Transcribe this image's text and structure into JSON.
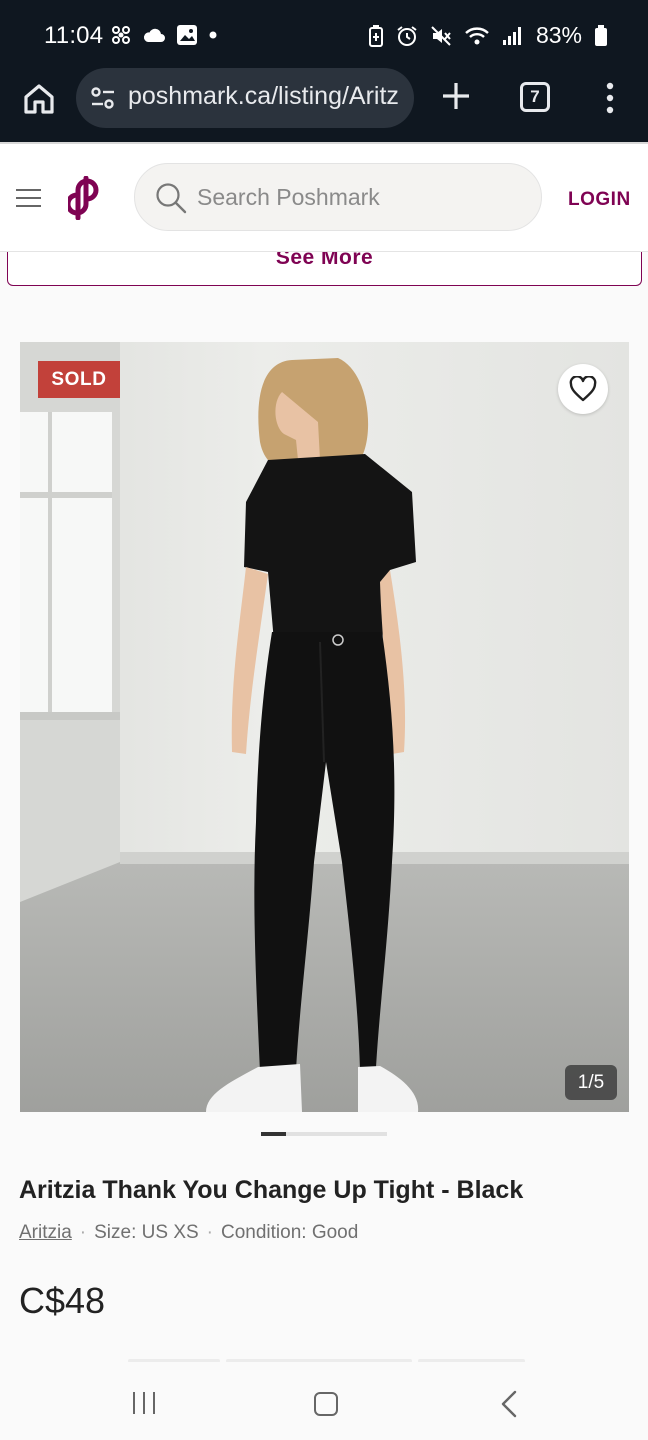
{
  "status_bar": {
    "time": "11:04",
    "left_icons": [
      "fan-icon",
      "cloud-icon",
      "image-icon",
      "dot-icon"
    ],
    "right_icons": [
      "battery-saver-icon",
      "alarm-icon",
      "mute-icon",
      "wifi-icon",
      "signal-icon"
    ],
    "battery": "83%"
  },
  "browser": {
    "url": "poshmark.ca/listing/Aritz",
    "tab_count": "7"
  },
  "header": {
    "search_placeholder": "Search Poshmark",
    "login_label": "LOGIN"
  },
  "see_more": {
    "label": "See More"
  },
  "listing": {
    "sold_label": "SOLD",
    "image_counter": "1/5",
    "title": "Aritzia Thank You Change Up Tight - Black",
    "brand": "Aritzia",
    "separator": "·",
    "size": "Size: US XS",
    "condition": "Condition: Good",
    "price": "C$48"
  },
  "colors": {
    "brand": "#7f0353",
    "sold": "#c2413a",
    "status_bg": "#0f1720"
  }
}
